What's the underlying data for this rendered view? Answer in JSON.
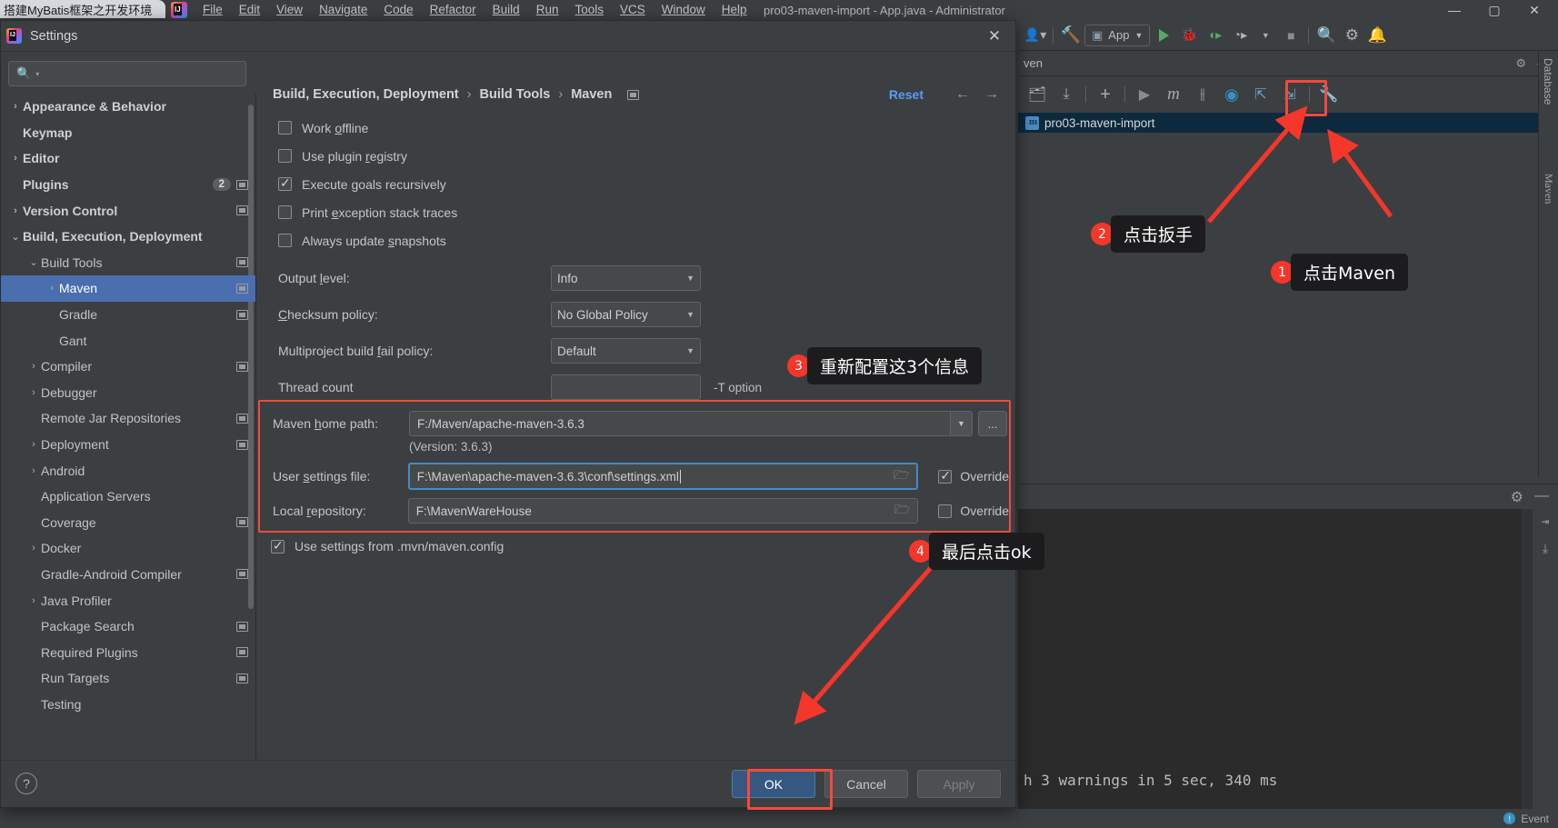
{
  "browser_tab": {
    "title": "搭建MyBatis框架之开发环境"
  },
  "ide": {
    "title": "pro03-maven-import - App.java - Administrator",
    "menu": [
      "File",
      "Edit",
      "View",
      "Navigate",
      "Code",
      "Refactor",
      "Build",
      "Run",
      "Tools",
      "VCS",
      "Window",
      "Help"
    ],
    "window_buttons": {
      "minimize": "—",
      "maximize": "▢",
      "close": "✕"
    },
    "toolbar": {
      "avatar_icon": "user-dropdown-icon",
      "build_icon": "hammer-icon",
      "run_config": "App",
      "run_icon": "run-icon",
      "debug_icon": "debug-icon",
      "coverage_icon": "coverage-icon",
      "profile_icon": "profiler-icon",
      "stop_icon": "stop-icon",
      "search_icon": "search-everywhere-icon",
      "settings_icon": "gear-icon"
    },
    "maven_panel": {
      "title": "ven",
      "toolbar_icons": [
        "add-maven-project-icon",
        "download-sources-icon",
        "plus-icon",
        "run-icon",
        "m-icon",
        "skip-tests-icon",
        "execute-goal-icon",
        "expand-icon",
        "collapse-icon",
        "wrench-icon"
      ],
      "project": "pro03-maven-import"
    },
    "right_rail": {
      "database": "Database",
      "maven": "Maven"
    },
    "console": {
      "text": "h 3 warnings in 5 sec, 340 ms"
    },
    "statusbar": {
      "events": "Event"
    }
  },
  "dialog": {
    "title": "Settings",
    "search": {
      "value": "",
      "placeholder": ""
    },
    "sidebar": [
      {
        "label": "Appearance & Behavior",
        "indent": 0,
        "chevron": "collapsed",
        "bold": true,
        "badge": null,
        "mini": false
      },
      {
        "label": "Keymap",
        "indent": 0,
        "chevron": "none",
        "bold": true,
        "badge": null,
        "mini": false
      },
      {
        "label": "Editor",
        "indent": 0,
        "chevron": "collapsed",
        "bold": true,
        "badge": null,
        "mini": false
      },
      {
        "label": "Plugins",
        "indent": 0,
        "chevron": "none",
        "bold": true,
        "badge": "2",
        "mini": true
      },
      {
        "label": "Version Control",
        "indent": 0,
        "chevron": "collapsed",
        "bold": true,
        "badge": null,
        "mini": true
      },
      {
        "label": "Build, Execution, Deployment",
        "indent": 0,
        "chevron": "expanded",
        "bold": true,
        "badge": null,
        "mini": false
      },
      {
        "label": "Build Tools",
        "indent": 1,
        "chevron": "expanded",
        "bold": false,
        "badge": null,
        "mini": true
      },
      {
        "label": "Maven",
        "indent": 2,
        "chevron": "collapsed",
        "bold": false,
        "badge": null,
        "mini": true,
        "selected": true
      },
      {
        "label": "Gradle",
        "indent": 2,
        "chevron": "none",
        "bold": false,
        "badge": null,
        "mini": true
      },
      {
        "label": "Gant",
        "indent": 2,
        "chevron": "none",
        "bold": false,
        "badge": null,
        "mini": false
      },
      {
        "label": "Compiler",
        "indent": 1,
        "chevron": "collapsed",
        "bold": false,
        "badge": null,
        "mini": true
      },
      {
        "label": "Debugger",
        "indent": 1,
        "chevron": "collapsed",
        "bold": false,
        "badge": null,
        "mini": false
      },
      {
        "label": "Remote Jar Repositories",
        "indent": 1,
        "chevron": "none",
        "bold": false,
        "badge": null,
        "mini": true
      },
      {
        "label": "Deployment",
        "indent": 1,
        "chevron": "collapsed",
        "bold": false,
        "badge": null,
        "mini": true
      },
      {
        "label": "Android",
        "indent": 1,
        "chevron": "collapsed",
        "bold": false,
        "badge": null,
        "mini": false
      },
      {
        "label": "Application Servers",
        "indent": 1,
        "chevron": "none",
        "bold": false,
        "badge": null,
        "mini": false
      },
      {
        "label": "Coverage",
        "indent": 1,
        "chevron": "none",
        "bold": false,
        "badge": null,
        "mini": true
      },
      {
        "label": "Docker",
        "indent": 1,
        "chevron": "collapsed",
        "bold": false,
        "badge": null,
        "mini": false
      },
      {
        "label": "Gradle-Android Compiler",
        "indent": 1,
        "chevron": "none",
        "bold": false,
        "badge": null,
        "mini": true
      },
      {
        "label": "Java Profiler",
        "indent": 1,
        "chevron": "collapsed",
        "bold": false,
        "badge": null,
        "mini": false
      },
      {
        "label": "Package Search",
        "indent": 1,
        "chevron": "none",
        "bold": false,
        "badge": null,
        "mini": true
      },
      {
        "label": "Required Plugins",
        "indent": 1,
        "chevron": "none",
        "bold": false,
        "badge": null,
        "mini": true
      },
      {
        "label": "Run Targets",
        "indent": 1,
        "chevron": "none",
        "bold": false,
        "badge": null,
        "mini": true
      },
      {
        "label": "Testing",
        "indent": 1,
        "chevron": "none",
        "bold": false,
        "badge": null,
        "mini": false
      }
    ],
    "breadcrumbs": [
      "Build, Execution, Deployment",
      "Build Tools",
      "Maven"
    ],
    "reset_label": "Reset",
    "checkboxes": [
      {
        "label_pre": "Work ",
        "mnemonic": "o",
        "label_post": "ffline",
        "checked": false
      },
      {
        "label_pre": "Use plugin ",
        "mnemonic": "r",
        "label_post": "egistry",
        "checked": false
      },
      {
        "label_pre": "Execute ",
        "mnemonic": "g",
        "label_post": "oals recursively",
        "checked": true
      },
      {
        "label_pre": "Print ",
        "mnemonic": "e",
        "label_post": "xception stack traces",
        "checked": false
      },
      {
        "label_pre": "Always update ",
        "mnemonic": "s",
        "label_post": "napshots",
        "checked": false
      }
    ],
    "fields": [
      {
        "label_pre": "Output ",
        "mnemonic": "l",
        "label_post": "evel:",
        "value": "Info",
        "type": "combo"
      },
      {
        "label_pre": "",
        "mnemonic": "C",
        "label_post": "hecksum policy:",
        "value": "No Global Policy",
        "type": "combo"
      },
      {
        "label_pre": "Multiproject build ",
        "mnemonic": "f",
        "label_post": "ail policy:",
        "value": "Default",
        "type": "combo"
      }
    ],
    "thread_count": {
      "label": "Thread count",
      "value": "",
      "suffix": "-T option"
    },
    "maven_home": {
      "label_pre": "Maven ",
      "mnemonic": "h",
      "label_post": "ome path:",
      "value": "F:/Maven/apache-maven-3.6.3",
      "ellipsis": "...",
      "version": "(Version: 3.6.3)"
    },
    "user_settings": {
      "label_pre": "User ",
      "mnemonic": "s",
      "label_post": "ettings file:",
      "value": "F:\\Maven\\apache-maven-3.6.3\\conf\\settings.xml",
      "override_label": "Override",
      "override_checked": true
    },
    "local_repo": {
      "label_pre": "Local ",
      "mnemonic": "r",
      "label_post": "epository:",
      "value": "F:\\MavenWareHouse",
      "override_label": "Override",
      "override_checked": false
    },
    "mvn_config": {
      "label": "Use settings from .mvn/maven.config",
      "checked": true
    },
    "buttons": {
      "ok": "OK",
      "cancel": "Cancel",
      "apply": "Apply",
      "help": "?"
    }
  },
  "annotations": [
    {
      "num": "1",
      "text": "点击Maven"
    },
    {
      "num": "2",
      "text": "点击扳手"
    },
    {
      "num": "3",
      "text": "重新配置这3个信息"
    },
    {
      "num": "4",
      "text": "最后点击ok"
    }
  ],
  "colors": {
    "accent_red": "#f4362b",
    "selection_blue": "#4b6eaf",
    "link_blue": "#589df6",
    "primary_button": "#365880",
    "panel_bg": "#3c3f41"
  }
}
